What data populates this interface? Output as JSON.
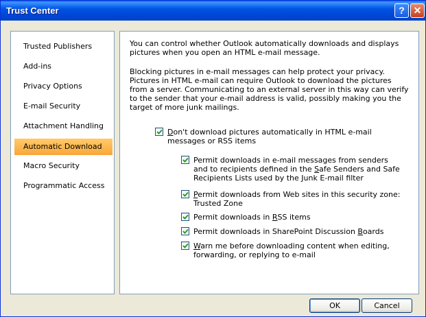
{
  "window": {
    "title": "Trust Center",
    "help_glyph": "?",
    "close_glyph": "✕"
  },
  "sidebar": {
    "items": [
      {
        "label": "Trusted Publishers"
      },
      {
        "label": "Add-ins"
      },
      {
        "label": "Privacy Options"
      },
      {
        "label": "E-mail Security"
      },
      {
        "label": "Attachment Handling"
      },
      {
        "label": "Automatic Download",
        "selected": true
      },
      {
        "label": "Macro Security"
      },
      {
        "label": "Programmatic Access"
      }
    ]
  },
  "content": {
    "intro": "You can control whether Outlook automatically downloads and displays pictures when you open an HTML e-mail message.",
    "privacy_note": "Blocking pictures in e-mail messages can help protect your privacy. Pictures in HTML e-mail can require Outlook to download the pictures from a server. Communicating to an external server in this way can verify to the sender that your e-mail address is valid, possibly making you the target of more junk mailings.",
    "main_option": {
      "label_prefix": "",
      "label_hotkey": "D",
      "label_rest": "on't download pictures automatically in HTML e-mail messages or RSS items",
      "checked": true
    },
    "sub_options": [
      {
        "pre": "Permit downloads in e-mail messages from senders and to recipients defined in the ",
        "hotkey": "S",
        "post": "afe Senders and Safe Recipients Lists used by the Junk E-mail filter",
        "checked": true
      },
      {
        "pre": "",
        "hotkey": "P",
        "post": "ermit downloads from Web sites in this security zone: Trusted Zone",
        "checked": true
      },
      {
        "pre": "Permit downloads in ",
        "hotkey": "R",
        "post": "SS items",
        "checked": true
      },
      {
        "pre": "Permit downloads in SharePoint Discussion ",
        "hotkey": "B",
        "post": "oards",
        "checked": true
      },
      {
        "pre": "",
        "hotkey": "W",
        "post": "arn me before downloading content when editing, forwarding, or replying to e-mail",
        "checked": true
      }
    ]
  },
  "footer": {
    "ok_label": "OK",
    "cancel_label": "Cancel"
  },
  "colors": {
    "title_bar": "#0055E5",
    "selected_item": "#F8A63A",
    "checkmark": "#21A121"
  }
}
